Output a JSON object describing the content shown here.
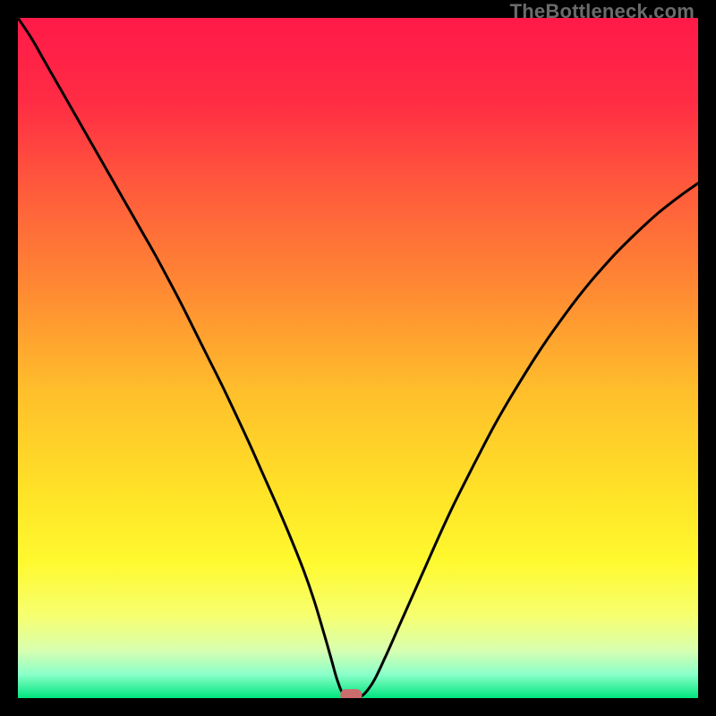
{
  "watermark": "TheBottleneck.com",
  "colors": {
    "frame": "#000000",
    "gradient_stops": [
      {
        "offset": 0.0,
        "color": "#ff1a49"
      },
      {
        "offset": 0.12,
        "color": "#ff2b44"
      },
      {
        "offset": 0.25,
        "color": "#ff5a3c"
      },
      {
        "offset": 0.4,
        "color": "#ff8a33"
      },
      {
        "offset": 0.55,
        "color": "#ffbf2b"
      },
      {
        "offset": 0.7,
        "color": "#ffe327"
      },
      {
        "offset": 0.8,
        "color": "#fff92f"
      },
      {
        "offset": 0.88,
        "color": "#f6ff70"
      },
      {
        "offset": 0.93,
        "color": "#d8ffb0"
      },
      {
        "offset": 0.965,
        "color": "#8bffca"
      },
      {
        "offset": 1.0,
        "color": "#00e57e"
      }
    ],
    "curve": "#000000",
    "marker": "#cc6d6d"
  },
  "chart_data": {
    "type": "line",
    "title": "",
    "xlabel": "",
    "ylabel": "",
    "xlim": [
      0,
      100
    ],
    "ylim": [
      0,
      100
    ],
    "x": [
      0,
      2,
      4,
      6,
      8,
      10,
      12,
      14,
      16,
      18,
      20,
      22,
      24,
      26,
      28,
      30,
      32,
      34,
      36,
      38,
      40,
      42,
      43.5,
      45,
      46,
      47,
      48,
      50,
      52,
      54,
      56,
      58,
      60,
      62,
      64,
      66,
      68,
      70,
      72,
      74,
      76,
      78,
      80,
      82,
      84,
      86,
      88,
      90,
      92,
      94,
      96,
      98,
      100
    ],
    "values": [
      100,
      97,
      93.5,
      90,
      86.5,
      83,
      79.5,
      76,
      72.5,
      69,
      65.5,
      61.8,
      58,
      54,
      50,
      46,
      41.8,
      37.5,
      33,
      28.5,
      23.8,
      18.8,
      14.5,
      9.5,
      6,
      2.5,
      0.5,
      0,
      2,
      6,
      10.5,
      15,
      19.5,
      24,
      28.3,
      32.3,
      36.2,
      40,
      43.5,
      46.8,
      50,
      53,
      55.8,
      58.5,
      61,
      63.3,
      65.5,
      67.5,
      69.4,
      71.2,
      72.8,
      74.3,
      75.7
    ],
    "marker": {
      "x": 49,
      "y": 0
    },
    "green_band_y": [
      0,
      3.5
    ]
  }
}
